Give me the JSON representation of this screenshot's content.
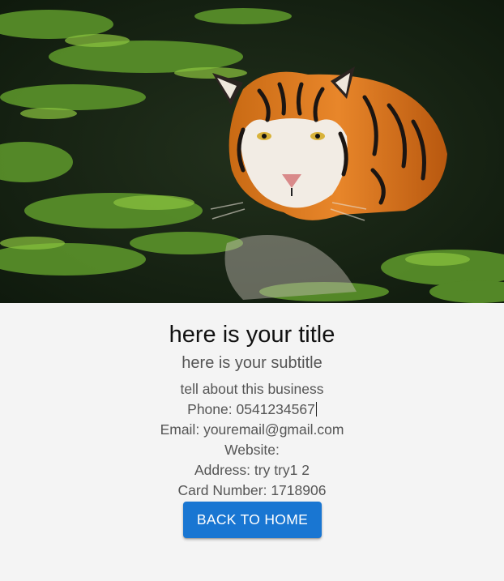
{
  "card": {
    "image_alt": "tiger swimming in green water",
    "title": "here is your title",
    "subtitle": "here is your subtitle",
    "description": "tell about this business",
    "phone_label": "Phone:",
    "phone": "0541234567",
    "email_label": "Email:",
    "email": "youremail@gmail.com",
    "website_label": "Website:",
    "website": "",
    "address_label": "Address:",
    "address": "try try1 2",
    "card_number_label": "Card Number:",
    "card_number": "1718906"
  },
  "actions": {
    "back_label": "BACK TO HOME"
  },
  "colors": {
    "primary": "#1976d2",
    "background": "#f4f4f4",
    "text": "#555555",
    "title": "#111111"
  }
}
